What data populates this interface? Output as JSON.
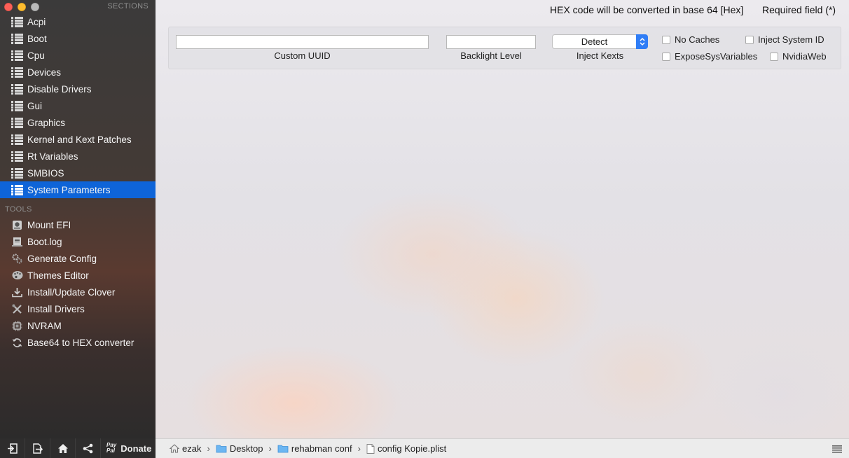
{
  "sidebar": {
    "sections_header": "SECTIONS",
    "sections": [
      {
        "label": "Acpi",
        "icon": "list-icon"
      },
      {
        "label": "Boot",
        "icon": "list-icon"
      },
      {
        "label": "Cpu",
        "icon": "list-icon"
      },
      {
        "label": "Devices",
        "icon": "list-icon"
      },
      {
        "label": "Disable Drivers",
        "icon": "list-icon"
      },
      {
        "label": "Gui",
        "icon": "list-icon"
      },
      {
        "label": "Graphics",
        "icon": "list-icon"
      },
      {
        "label": "Kernel and Kext Patches",
        "icon": "list-icon"
      },
      {
        "label": "Rt Variables",
        "icon": "list-icon"
      },
      {
        "label": "SMBIOS",
        "icon": "list-icon"
      },
      {
        "label": "System Parameters",
        "icon": "list-icon",
        "selected": true
      }
    ],
    "tools_header": "TOOLS",
    "tools": [
      {
        "label": "Mount EFI",
        "icon": "disk-icon"
      },
      {
        "label": "Boot.log",
        "icon": "log-icon"
      },
      {
        "label": "Generate Config",
        "icon": "gears-icon"
      },
      {
        "label": "Themes Editor",
        "icon": "palette-icon"
      },
      {
        "label": "Install/Update Clover",
        "icon": "download-icon"
      },
      {
        "label": "Install Drivers",
        "icon": "tools-icon"
      },
      {
        "label": "NVRAM",
        "icon": "chip-icon"
      },
      {
        "label": "Base64 to HEX converter",
        "icon": "convert-icon"
      }
    ]
  },
  "bottom_toolbar": {
    "paypal_line1": "Pay",
    "paypal_line2": "Pal",
    "donate_label": "Donate"
  },
  "header": {
    "hex_note": "HEX code will be converted in base 64 [Hex]",
    "required_note": "Required field (*)"
  },
  "form": {
    "custom_uuid": {
      "label": "Custom UUID",
      "value": ""
    },
    "backlight_level": {
      "label": "Backlight Level",
      "value": ""
    },
    "inject_kexts": {
      "label": "Inject Kexts",
      "value": "Detect"
    },
    "checkboxes": {
      "no_caches": {
        "label": "No Caches",
        "checked": false
      },
      "inject_system_id": {
        "label": "Inject System ID",
        "checked": false
      },
      "expose_sys_variables": {
        "label": "ExposeSysVariables",
        "checked": false
      },
      "nvidia_web": {
        "label": "NvidiaWeb",
        "checked": false
      }
    }
  },
  "pathbar": {
    "crumbs": [
      "ezak",
      "Desktop",
      "rehabman conf",
      "config Kopie.plist"
    ],
    "separator": "›"
  },
  "colors": {
    "selection": "#0e64d8",
    "select_arrow": "#2f7df6",
    "close": "#fc5f57",
    "minimize": "#fdbc2e"
  }
}
